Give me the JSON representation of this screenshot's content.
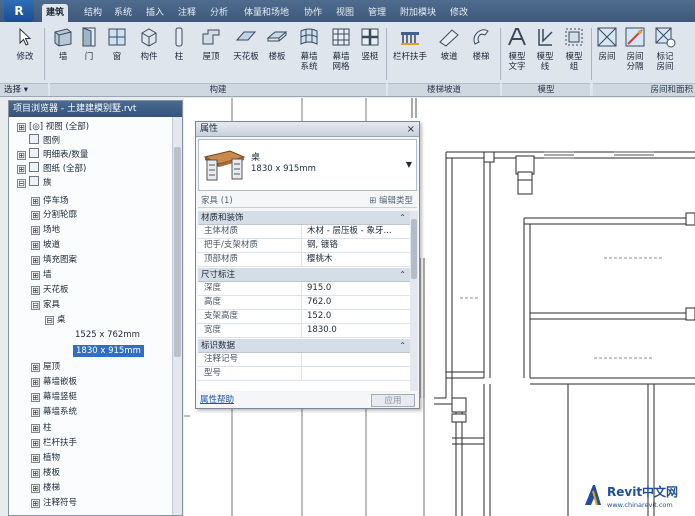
{
  "ribbon": {
    "app_button": "R",
    "tabs": [
      "建筑",
      "结构",
      "系统",
      "插入",
      "注释",
      "分析",
      "体量和场地",
      "协作",
      "视图",
      "管理",
      "附加模块",
      "修改"
    ],
    "tools": [
      "修改",
      "墙",
      "门",
      "窗",
      "构件",
      "柱",
      "屋顶",
      "天花板",
      "楼板",
      "幕墙\n系统",
      "幕墙\n网格",
      "竖梃",
      "栏杆扶手",
      "坡道",
      "楼梯",
      "模型\n文字",
      "模型\n线",
      "模型\n组",
      "房间",
      "房间\n分隔",
      "标记\n房间"
    ],
    "panels": {
      "select": "选择 ▾",
      "build": "构建",
      "circulation": "楼梯坡道",
      "model": "模型",
      "room": "房间和面积"
    }
  },
  "browser": {
    "title": "项目浏览器 - 土建建模别墅.rvt",
    "items": [
      {
        "toggle": "⊞",
        "label": "[◎] 视图 (全部)"
      },
      {
        "toggle": "",
        "label": "图例"
      },
      {
        "toggle": "⊞",
        "label": "明细表/数量"
      },
      {
        "toggle": "⊞",
        "label": "图纸 (全部)"
      },
      {
        "toggle": "⊟",
        "label": "族"
      },
      {
        "toggle": "⊞",
        "label": "停车场"
      },
      {
        "toggle": "⊞",
        "label": "分割轮廓"
      },
      {
        "toggle": "⊞",
        "label": "场地"
      },
      {
        "toggle": "⊞",
        "label": "坡道"
      },
      {
        "toggle": "⊞",
        "label": "填充图案"
      },
      {
        "toggle": "⊞",
        "label": "墙"
      },
      {
        "toggle": "⊞",
        "label": "天花板"
      },
      {
        "toggle": "⊟",
        "label": "家具"
      },
      {
        "toggle": "⊟",
        "label": "桌"
      },
      {
        "toggle": "",
        "label": "1525 x 762mm"
      },
      {
        "toggle": "",
        "label": "1830 x 915mm"
      },
      {
        "toggle": "⊞",
        "label": "屋顶"
      },
      {
        "toggle": "⊞",
        "label": "幕墙嵌板"
      },
      {
        "toggle": "⊞",
        "label": "幕墙竖梃"
      },
      {
        "toggle": "⊞",
        "label": "幕墙系统"
      },
      {
        "toggle": "⊞",
        "label": "柱"
      },
      {
        "toggle": "⊞",
        "label": "栏杆扶手"
      },
      {
        "toggle": "⊞",
        "label": "植物"
      },
      {
        "toggle": "⊞",
        "label": "楼板"
      },
      {
        "toggle": "⊞",
        "label": "楼梯"
      },
      {
        "toggle": "⊞",
        "label": "注释符号"
      }
    ]
  },
  "properties": {
    "title": "属性",
    "close": "×",
    "type_name": "桌",
    "type_size": "1830 x 915mm",
    "instance_filter": "家具 (1)",
    "edit_type": "编辑类型",
    "groups": [
      {
        "name": "材质和装饰",
        "rows": [
          {
            "key": "主体材质",
            "value": "木材 - 层压板 - 象牙..."
          },
          {
            "key": "把手/支架材质",
            "value": "钢, 镀铬"
          },
          {
            "key": "顶部材质",
            "value": "樱桃木"
          }
        ]
      },
      {
        "name": "尺寸标注",
        "rows": [
          {
            "key": "深度",
            "value": "915.0"
          },
          {
            "key": "高度",
            "value": "762.0"
          },
          {
            "key": "支架高度",
            "value": "152.0"
          },
          {
            "key": "宽度",
            "value": "1830.0"
          }
        ]
      },
      {
        "name": "标识数据",
        "rows": [
          {
            "key": "注释记号",
            "value": ""
          },
          {
            "key": "型号",
            "value": ""
          }
        ]
      }
    ],
    "help_link": "属性帮助",
    "apply": "应用"
  },
  "watermark": {
    "main": "Revit中文网",
    "sub": "www.chinarevit.com"
  },
  "colors": {
    "tab_bar": "#3d587a",
    "ribbon_bg": "#dfe5ec",
    "selection": "#2f6ec1",
    "watermark": "#1e4e9c"
  }
}
